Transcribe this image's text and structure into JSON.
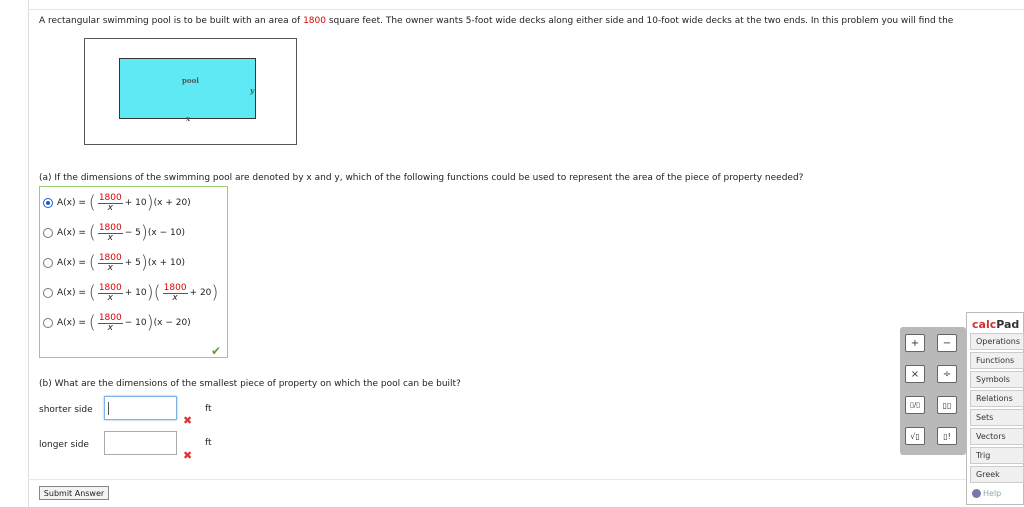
{
  "problem": {
    "text_before": "A rectangular swimming pool is to be built with an area of ",
    "area_value": "1800",
    "text_after": " square feet. The owner wants 5-foot wide decks along either side and 10-foot wide decks at the two ends. In this problem you will find the"
  },
  "diagram": {
    "pool_label": "pool",
    "x_label": "x",
    "y_label": "y",
    "pool_color": "#5ee9f5"
  },
  "part_a": {
    "question": "(a) If the dimensions of the swimming pool are denoted by x and y, which of the following functions could be used to represent the area of the piece of property needed?",
    "selected_index": 0,
    "correct": true,
    "choices": [
      {
        "lhs": "A(x) =",
        "num": "1800",
        "den": "x",
        "mid": "+ 10",
        "tail": "(x + 20)"
      },
      {
        "lhs": "A(x) =",
        "num": "1800",
        "den": "x",
        "mid": "− 5",
        "tail": "(x − 10)"
      },
      {
        "lhs": "A(x) =",
        "num": "1800",
        "den": "x",
        "mid": "+ 5",
        "tail": "(x + 10)"
      },
      {
        "lhs": "A(x) =",
        "num": "1800",
        "den": "x",
        "mid": "+ 10",
        "num2": "1800",
        "den2": "x",
        "mid2": "+ 20"
      },
      {
        "lhs": "A(x) =",
        "num": "1800",
        "den": "x",
        "mid": "− 10",
        "tail": "(x − 20)"
      }
    ]
  },
  "part_b": {
    "question": "(b) What are the dimensions of the smallest piece of property on which the pool can be built?",
    "shorter_label": "shorter side",
    "shorter_value": "",
    "longer_label": "longer side",
    "longer_value": "",
    "unit": "ft"
  },
  "submit_label": "Submit Answer",
  "calcpad": {
    "title_calc": "calc",
    "title_pad": "Pad",
    "keys": [
      "+",
      "−",
      "×",
      "÷",
      "▯/▯",
      "▯▯",
      "√▯",
      "▯!"
    ],
    "tabs": [
      "Operations",
      "Functions",
      "Symbols",
      "Relations",
      "Sets",
      "Vectors",
      "Trig",
      "Greek"
    ],
    "help": "Help"
  }
}
